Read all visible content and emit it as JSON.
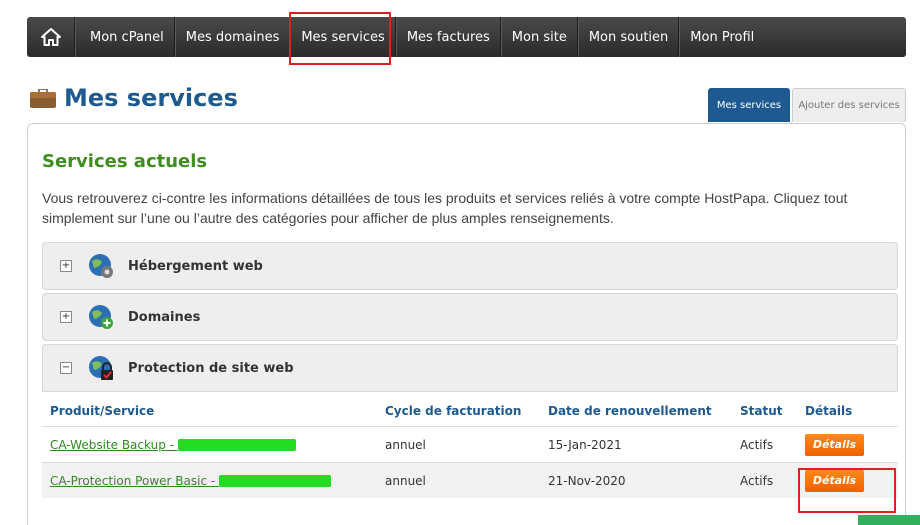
{
  "nav": {
    "home_icon": "home-icon",
    "items": [
      {
        "label": "Mon cPanel"
      },
      {
        "label": "Mes domaines"
      },
      {
        "label": "Mes services"
      },
      {
        "label": "Mes factures"
      },
      {
        "label": "Mon site"
      },
      {
        "label": "Mon soutien"
      },
      {
        "label": "Mon Profil"
      }
    ]
  },
  "header": {
    "title": "Mes services",
    "tabs": [
      {
        "label": "Mes services"
      },
      {
        "label": "Ajouter des services"
      }
    ]
  },
  "panel": {
    "heading": "Services actuels",
    "description": "Vous retrouverez ci-contre les informations détaillées de tous les produits et services reliés à votre compte HostPapa. Cliquez tout simplement sur l’une ou l’autre des catégories pour afficher de plus amples renseignements.",
    "categories": [
      {
        "toggle": "+",
        "label": "Hébergement web"
      },
      {
        "toggle": "+",
        "label": "Domaines"
      },
      {
        "toggle": "−",
        "label": "Protection de site web"
      }
    ],
    "table": {
      "headers": [
        "Produit/Service",
        "Cycle de facturation",
        "Date de renouvellement",
        "Statut",
        "Détails"
      ],
      "rows": [
        {
          "product": "CA-Website Backup - ",
          "cycle": "annuel",
          "renewal": "15-Jan-2021",
          "status": "Actifs",
          "button": "Détails"
        },
        {
          "product": "CA-Protection Power Basic - ",
          "cycle": "annuel",
          "renewal": "21-Nov-2020",
          "status": "Actifs",
          "button": "Détails"
        }
      ]
    }
  },
  "colors": {
    "nav_bg": "#333333",
    "title_blue": "#1d5a8f",
    "heading_green": "#3e8d1e",
    "button_orange": "#f47306",
    "highlight_red": "#e02020",
    "redaction_green": "#22dd22"
  }
}
